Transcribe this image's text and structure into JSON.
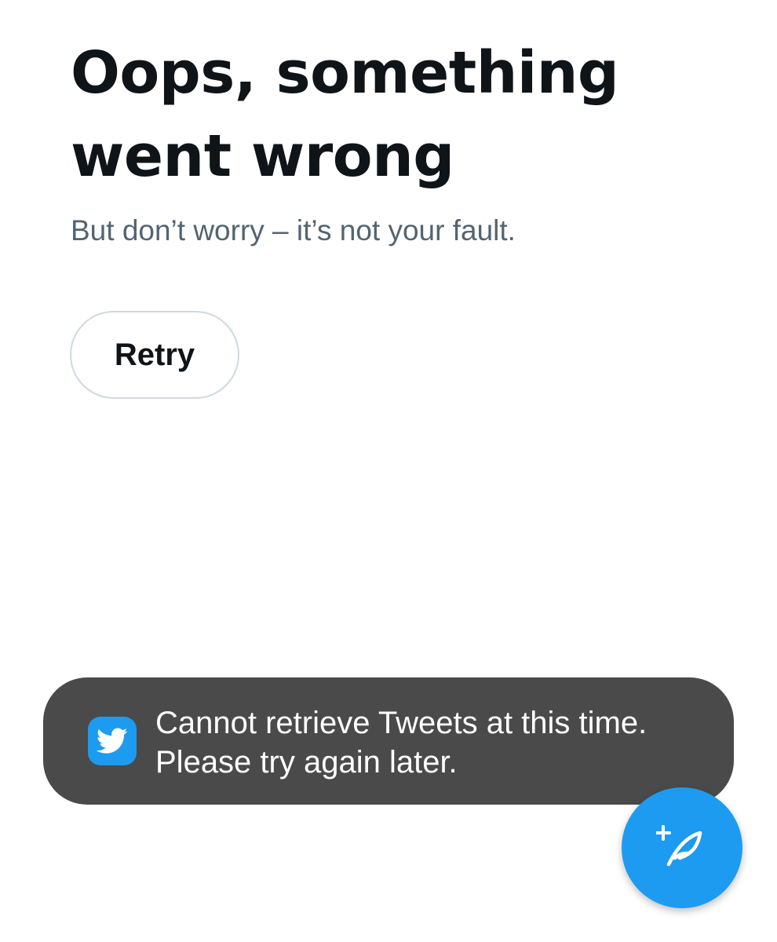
{
  "error": {
    "title": "Oops, something went wrong",
    "subtitle": "But don’t worry – it’s not your fault.",
    "retry_label": "Retry"
  },
  "toast": {
    "icon": "twitter-bird-icon",
    "message": "Cannot retrieve Tweets at this time. Please try again later."
  },
  "fab": {
    "icon": "compose-tweet-icon"
  },
  "colors": {
    "accent": "#1d9bf0",
    "text_primary": "#0f1419",
    "text_secondary": "#536471",
    "toast_background": "#4a4a4a",
    "button_border": "#cfd9de"
  }
}
